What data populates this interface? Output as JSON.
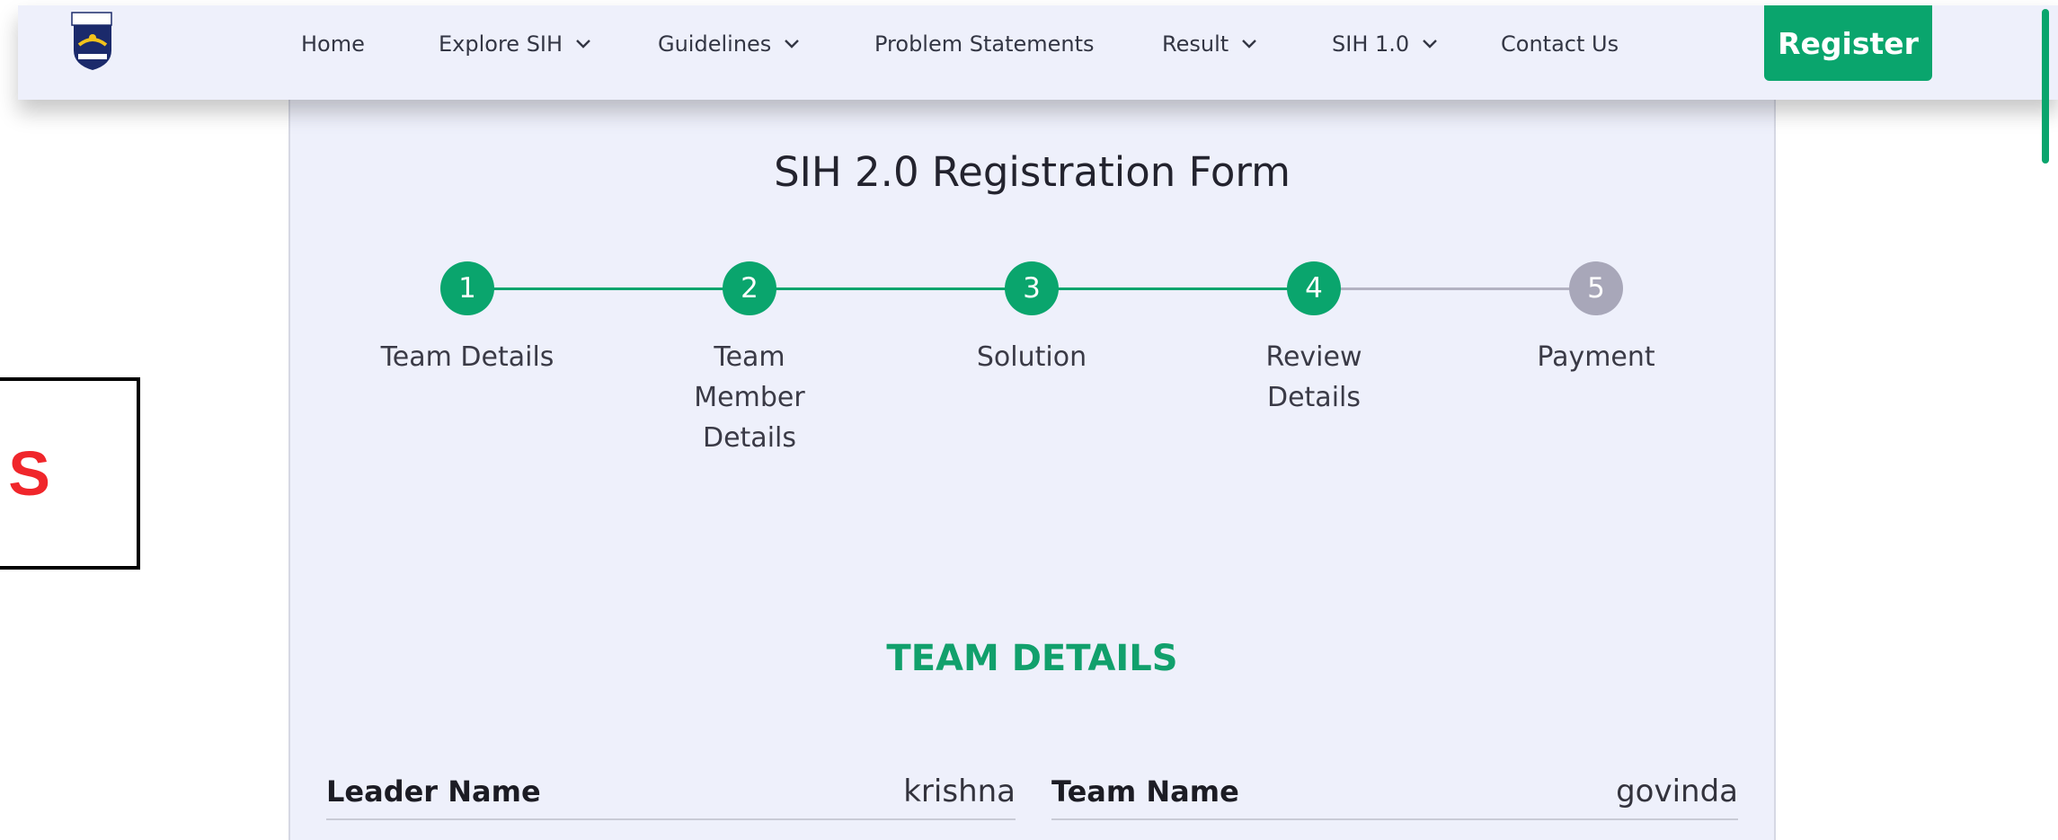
{
  "side_box": {
    "text": "S"
  },
  "nav": {
    "items": [
      {
        "label": "Home",
        "has_dropdown": false
      },
      {
        "label": "Explore SIH",
        "has_dropdown": true
      },
      {
        "label": "Guidelines",
        "has_dropdown": true
      },
      {
        "label": "Problem Statements",
        "has_dropdown": false
      },
      {
        "label": "Result",
        "has_dropdown": true
      },
      {
        "label": "SIH 1.0",
        "has_dropdown": true
      },
      {
        "label": "Contact Us",
        "has_dropdown": false
      }
    ],
    "register_label": "Register",
    "logo_icon": "sis-tech-shield-logo"
  },
  "form": {
    "title": "SIH 2.0 Registration Form",
    "steps": [
      {
        "number": "1",
        "label": "Team Details",
        "status": "complete"
      },
      {
        "number": "2",
        "label": "Team Member Details",
        "status": "complete"
      },
      {
        "number": "3",
        "label": "Solution",
        "status": "complete"
      },
      {
        "number": "4",
        "label": "Review Details",
        "status": "current"
      },
      {
        "number": "5",
        "label": "Payment",
        "status": "pending"
      }
    ],
    "section_heading": "TEAM DETAILS",
    "fields": [
      {
        "label": "Leader Name",
        "value": "krishna"
      },
      {
        "label": "Team Name",
        "value": "govinda"
      }
    ]
  },
  "colors": {
    "accent": "#0aa56d",
    "pending": "#a8a7b9",
    "card_bg": "#eef0fb",
    "side_text": "#f0262b"
  }
}
